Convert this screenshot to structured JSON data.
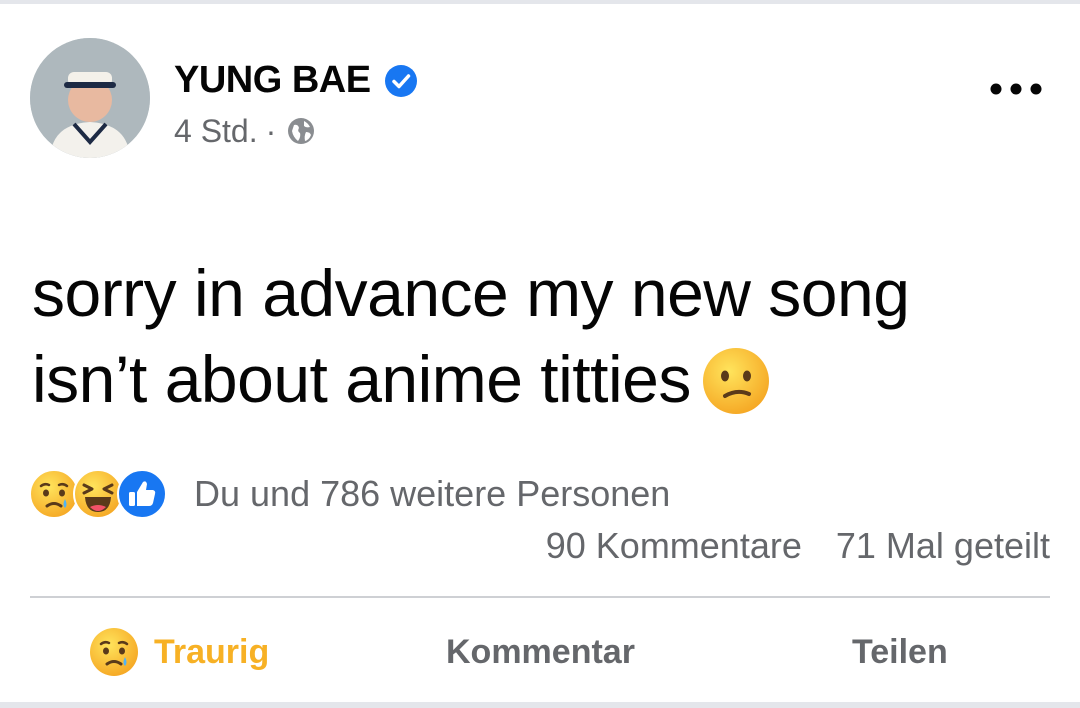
{
  "post": {
    "author": "YUNG BAE",
    "time": "4 Std.",
    "separator": "·",
    "text_line1": "sorry in advance my new song",
    "text_line2": "isn’t about anime titties",
    "inline_emoji": "confused-face-icon"
  },
  "reactions": {
    "icons": [
      "sad-face-icon",
      "laughing-face-icon",
      "like-icon"
    ],
    "summary": "Du und 786 weitere Personen",
    "comments": "90 Kommentare",
    "shares": "71 Mal geteilt"
  },
  "actions": {
    "react_label": "Traurig",
    "comment_label": "Kommentar",
    "share_label": "Teilen"
  },
  "colors": {
    "verified_blue": "#1877f2",
    "sad_yellow": "#f7b125",
    "secondary_text": "#65676b"
  }
}
